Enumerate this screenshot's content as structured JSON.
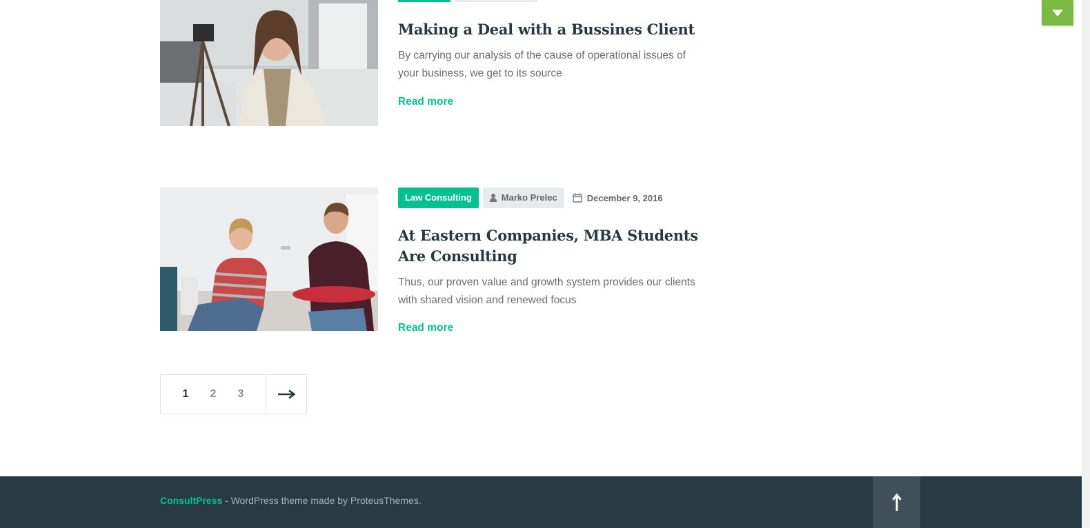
{
  "posts": [
    {
      "title": "Making a Deal with a Bussines Client",
      "excerpt": "By carrying our analysis of the cause of operational issues of your business, we get to its source",
      "read_more": "Read more",
      "image_icon": "photo-woman-tripod"
    },
    {
      "category": "Law Consulting",
      "author": "Marko Prelec",
      "date": "December 9, 2016",
      "title": "At Eastern Companies, MBA Students Are Consulting",
      "excerpt": "Thus, our proven value and growth system provides our clients with shared vision and renewed focus",
      "read_more": "Read more",
      "image_icon": "photo-two-men-office"
    }
  ],
  "pagination": {
    "pages": [
      "1",
      "2",
      "3"
    ],
    "current": "1",
    "next_icon": "arrow-right-icon"
  },
  "footer": {
    "brand": "ConsultPress",
    "text": " - WordPress theme made by ProteusThemes.",
    "back_to_top_icon": "arrow-up-icon"
  },
  "colors": {
    "accent": "#04c18f",
    "footer_bg": "#283a42",
    "title": "#273840",
    "toggle": "#7bb942"
  }
}
